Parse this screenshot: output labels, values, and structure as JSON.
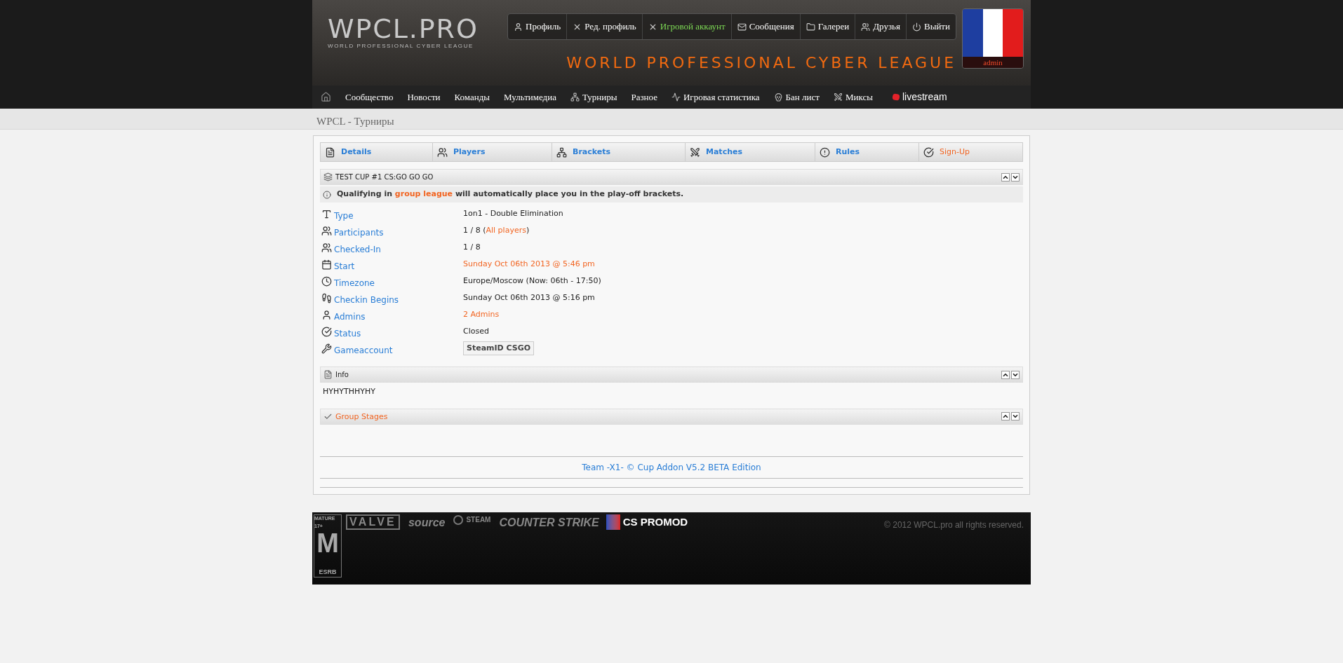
{
  "header": {
    "logo": "WPCL.PRO",
    "logo_subtitle": "WORLD PROFESSIONAL CYBER LEAGUE",
    "tagline": "WORLD PROFESSIONAL CYBER LEAGUE",
    "user_menu": [
      {
        "label": "Профиль",
        "selected": false
      },
      {
        "label": "Ред. профиль",
        "selected": false
      },
      {
        "label": "Игровой аккаунт",
        "selected": true
      },
      {
        "label": "Сообщения",
        "selected": false
      },
      {
        "label": "Галереи",
        "selected": false
      },
      {
        "label": "Друзья",
        "selected": false
      },
      {
        "label": "Выйти",
        "selected": false
      }
    ],
    "avatar": {
      "username": "admin"
    }
  },
  "nav": {
    "items": [
      {
        "label": "Сообщество"
      },
      {
        "label": "Новости"
      },
      {
        "label": "Команды"
      },
      {
        "label": "Мультимедиа"
      },
      {
        "label": "Турниры"
      },
      {
        "label": "Разное"
      },
      {
        "label": "Игровая статистика"
      },
      {
        "label": "Бан лист"
      },
      {
        "label": "Миксы"
      }
    ],
    "livestream": "livestream"
  },
  "page_title": "WPCL - Турниры",
  "tabs": [
    {
      "label": "Details",
      "kind": "link"
    },
    {
      "label": "Players",
      "kind": "link"
    },
    {
      "label": "Brackets",
      "kind": "link"
    },
    {
      "label": "Matches",
      "kind": "link"
    },
    {
      "label": "Rules",
      "kind": "link"
    },
    {
      "label": "Sign-Up",
      "kind": "action"
    }
  ],
  "tournament": {
    "title": "TEST CUP #1 CS:GO GO GO",
    "notice": [
      {
        "text": "Qualifying in ",
        "kind": "plain"
      },
      {
        "text": "group league",
        "kind": "link"
      },
      {
        "text": " will automatically place you in the play-off brackets.",
        "kind": "plain"
      }
    ],
    "fields": [
      {
        "label": "Type",
        "value": [
          {
            "text": "1on1 - Double Elimination",
            "kind": "plain"
          }
        ]
      },
      {
        "label": "Participants",
        "value": [
          {
            "text": "1 / 8 (",
            "kind": "plain"
          },
          {
            "text": "All players",
            "kind": "link"
          },
          {
            "text": ")",
            "kind": "plain"
          }
        ]
      },
      {
        "label": "Checked-In",
        "value": [
          {
            "text": "1 / 8",
            "kind": "plain"
          }
        ]
      },
      {
        "label": "Start",
        "value": [
          {
            "text": "Sunday Oct 06th 2013 @ 5:46 pm",
            "kind": "link"
          }
        ]
      },
      {
        "label": "Timezone",
        "value": [
          {
            "text": "Europe/Moscow (Now: 06th - 17:50)",
            "kind": "plain"
          }
        ]
      },
      {
        "label": "Checkin Begins",
        "value": [
          {
            "text": "Sunday Oct 06th 2013 @ 5:16 pm",
            "kind": "plain"
          }
        ]
      },
      {
        "label": "Admins",
        "value": [
          {
            "text": "2 Admins",
            "kind": "link"
          }
        ]
      },
      {
        "label": "Status",
        "value": [
          {
            "text": "Closed",
            "kind": "plain"
          }
        ]
      },
      {
        "label": "Gameaccount",
        "value": [
          {
            "text": "SteamID CSGO",
            "kind": "badge"
          }
        ]
      }
    ]
  },
  "info": {
    "title": "Info",
    "text": "HYHYTHHYHY"
  },
  "group_stages": {
    "title": "Group Stages"
  },
  "addon_credit": "Team -X1- © Cup Addon V5.2 BETA Edition",
  "footer": {
    "logos": [
      {
        "text": "MATURE 17+",
        "kind": "rating"
      },
      {
        "text": "VALVE",
        "kind": "boxed"
      },
      {
        "text": "source",
        "kind": "plain"
      },
      {
        "text": "STEAM",
        "kind": "steam"
      },
      {
        "text": "COUNTER STRIKE",
        "kind": "plain"
      },
      {
        "text": "CS PROMOD",
        "kind": "promod"
      }
    ],
    "rating_letter": "M",
    "rating_note": "ESRB",
    "copyright": "© 2012 WPCL.pro all rights reserved."
  }
}
